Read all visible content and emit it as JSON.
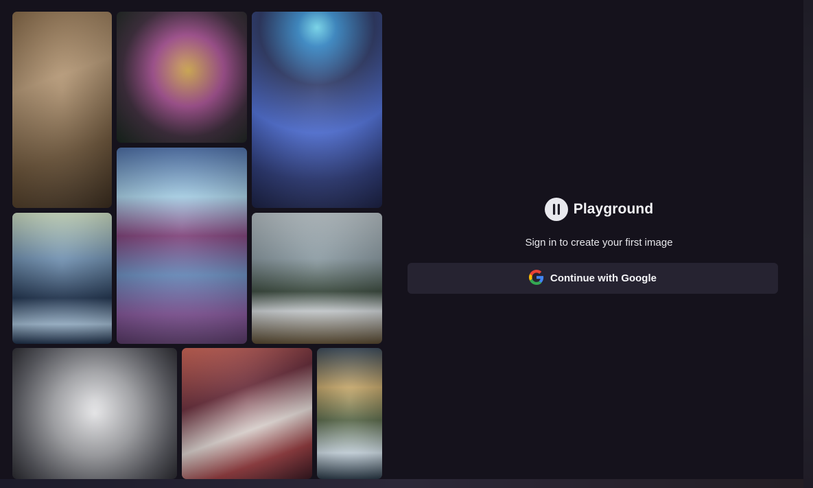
{
  "gallery": {
    "tiles": [
      {
        "name": "old-man-portrait"
      },
      {
        "name": "ornate-cat"
      },
      {
        "name": "blue-haired-girl"
      },
      {
        "name": "lighthouse-scene"
      },
      {
        "name": "ghost-ship"
      },
      {
        "name": "snowy-mountains"
      },
      {
        "name": "silver-wolf"
      },
      {
        "name": "robot-girl"
      },
      {
        "name": "forest-in-jar"
      }
    ]
  },
  "brand": {
    "name": "Playground",
    "logo_icon": "playground-logo-icon"
  },
  "auth": {
    "tagline": "Sign in to create your first image",
    "google_button_label": "Continue with Google",
    "google_icon": "google-g-icon"
  },
  "colors": {
    "background": "#15121c",
    "button_bg": "#262331",
    "text": "#f2f2f5"
  }
}
